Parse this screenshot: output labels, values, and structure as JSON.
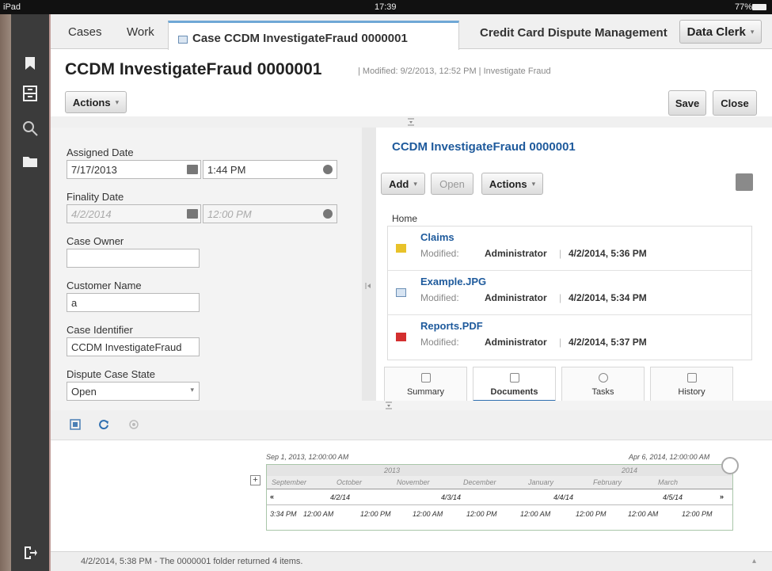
{
  "status_bar": {
    "device": "iPad",
    "time": "17:39",
    "battery": "77%"
  },
  "tabs": [
    {
      "label": "Cases"
    },
    {
      "label": "Work"
    },
    {
      "label": "Case CCDM  InvestigateFraud  0000001",
      "active": true
    }
  ],
  "header": {
    "app_title": "Credit Card Dispute Management",
    "role": "Data Clerk"
  },
  "case": {
    "title": "CCDM  InvestigateFraud  0000001",
    "modified": "| Modified: 9/2/2013, 12:52 PM | Investigate Fraud"
  },
  "toolbar": {
    "actions_label": "Actions",
    "save_label": "Save",
    "close_label": "Close"
  },
  "form": {
    "assigned_date": {
      "label": "Assigned Date",
      "date": "7/17/2013",
      "time": "1:44 PM"
    },
    "finality_date": {
      "label": "Finality Date",
      "date": "4/2/2014",
      "time": "12:00 PM"
    },
    "case_owner": {
      "label": "Case Owner",
      "value": ""
    },
    "customer_name": {
      "label": "Customer Name",
      "value": "a"
    },
    "case_identifier": {
      "label": "Case Identifier",
      "value": "CCDM  InvestigateFraud"
    },
    "dispute_case_state": {
      "label": "Dispute Case State",
      "value": "Open"
    }
  },
  "folder": {
    "title": "CCDM  InvestigateFraud  0000001",
    "add_label": "Add",
    "open_label": "Open",
    "actions_label": "Actions",
    "breadcrumb": "Home",
    "items": [
      {
        "name": "Claims",
        "modified_label": "Modified:",
        "by": "Administrator",
        "date": "4/2/2014, 5:36 PM",
        "icon": "folder-icon"
      },
      {
        "name": "Example.JPG",
        "modified_label": "Modified:",
        "by": "Administrator",
        "date": "4/2/2014, 5:34 PM",
        "icon": "image-file-icon"
      },
      {
        "name": "Reports.PDF",
        "modified_label": "Modified:",
        "by": "Administrator",
        "date": "4/2/2014, 5:37 PM",
        "icon": "pdf-file-icon"
      }
    ]
  },
  "view_tabs": [
    {
      "label": "Summary"
    },
    {
      "label": "Documents",
      "active": true
    },
    {
      "label": "Tasks"
    },
    {
      "label": "History"
    }
  ],
  "timeline": {
    "range_start": "Sep 1, 2013, 12:00:00 AM",
    "range_end": "Apr 6, 2014, 12:00:00 AM",
    "years": [
      "2013",
      "2014"
    ],
    "months": [
      "September",
      "October",
      "November",
      "December",
      "January",
      "February",
      "March"
    ],
    "dates": [
      "4/2/14",
      "4/3/14",
      "4/4/14",
      "4/5/14"
    ],
    "times": [
      "3:34 PM",
      "12:00 AM",
      "12:00 PM",
      "12:00 AM",
      "12:00 PM",
      "12:00 AM",
      "12:00 PM",
      "12:00 AM",
      "12:00 PM"
    ]
  },
  "footer": {
    "message": "4/2/2014, 5:38 PM - The 0000001 folder returned 4 items."
  },
  "colors": {
    "accent_link": "#1e5a9c",
    "tab_highlight": "#6fa8d6",
    "sidebar": "#3b3b3b"
  }
}
